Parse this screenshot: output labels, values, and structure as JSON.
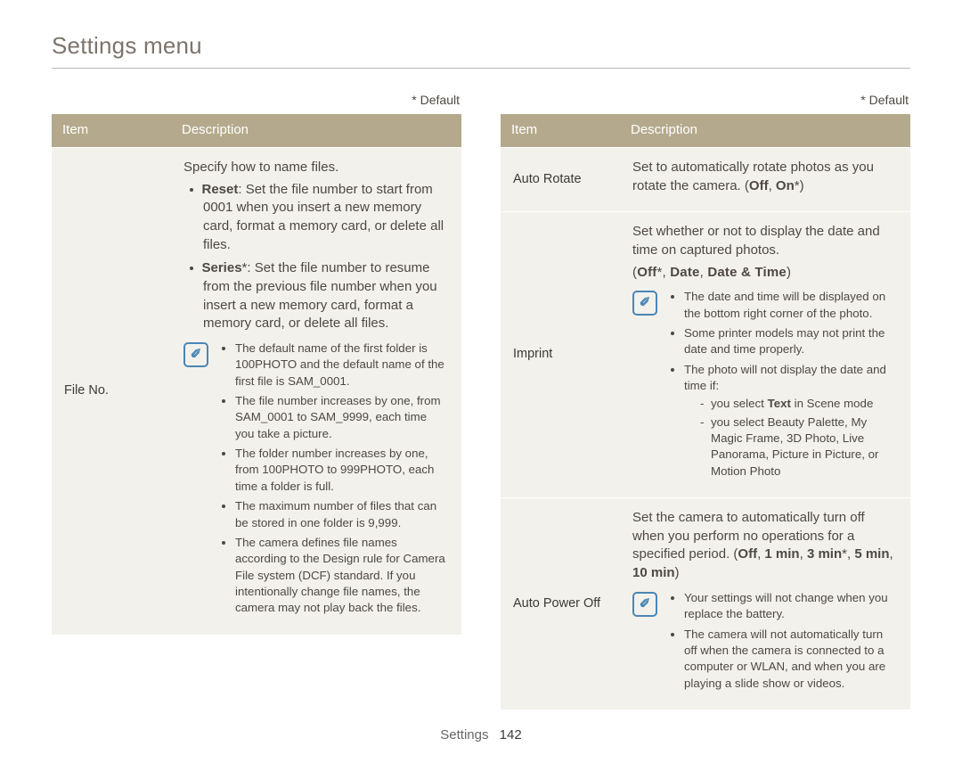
{
  "sectionTitle": "Settings menu",
  "defaultNote": "* Default",
  "headers": {
    "item": "Item",
    "description": "Description"
  },
  "noteGlyph": "✐",
  "footer": {
    "label": "Settings",
    "page": "142"
  },
  "left": {
    "fileNo": {
      "item": "File No.",
      "summary": "Specify how to name files.",
      "bullets": [
        {
          "label": "Reset",
          "text": ": Set the file number to start from 0001 when you insert a new memory card, format a memory card, or delete all files."
        },
        {
          "label": "Series",
          "star": "*",
          "text": ": Set the file number to resume from the previous file number when you insert a new memory card, format a memory card, or delete all files."
        }
      ],
      "notes": [
        "The default name of the first folder is 100PHOTO and the default name of the first file is SAM_0001.",
        "The file number increases by one, from SAM_0001 to SAM_9999, each time you take a picture.",
        "The folder number increases by one, from 100PHOTO to 999PHOTO, each time a folder is full.",
        "The maximum number of files that can be stored in one folder is 9,999.",
        "The camera defines file names according to the Design rule for Camera File system (DCF) standard. If you intentionally change file names, the camera may not play back the files."
      ]
    }
  },
  "right": {
    "autoRotate": {
      "item": "Auto Rotate",
      "text": "Set to automatically rotate photos as you rotate the camera. (",
      "options": {
        "off": "Off",
        "on": "On",
        "onStar": "*"
      },
      "close": ")"
    },
    "imprint": {
      "item": "Imprint",
      "line1": "Set whether or not to display the date and time on captured photos.",
      "optsOpen": "(",
      "options": {
        "off": "Off",
        "offStar": "*",
        "date": "Date",
        "dateTime": "Date & Time"
      },
      "optsClose": ")",
      "notes": [
        "The date and time will be displayed on the bottom right corner of the photo.",
        "Some printer models may not print the date and time properly.",
        "The photo will not display the date and time if:"
      ],
      "dash": [
        {
          "pre": "you select ",
          "bold": "Text",
          "post": " in Scene mode"
        },
        {
          "pre": "you select Beauty Palette, My Magic Frame, 3D Photo, Live Panorama, Picture in Picture, or Motion Photo",
          "bold": "",
          "post": ""
        }
      ]
    },
    "autoPowerOff": {
      "item": "Auto Power Off",
      "line1": "Set the camera to automatically turn off when you perform no operations for a specified period. (",
      "options": {
        "off": "Off",
        "m1": "1 min",
        "m3": "3 min",
        "m3Star": "*",
        "m5": "5 min",
        "m10": "10 min"
      },
      "close": ")",
      "notes": [
        "Your settings will not change when you replace the battery.",
        "The camera will not automatically turn off when the camera is connected to a computer or WLAN, and when you are playing a slide show or videos."
      ]
    }
  }
}
